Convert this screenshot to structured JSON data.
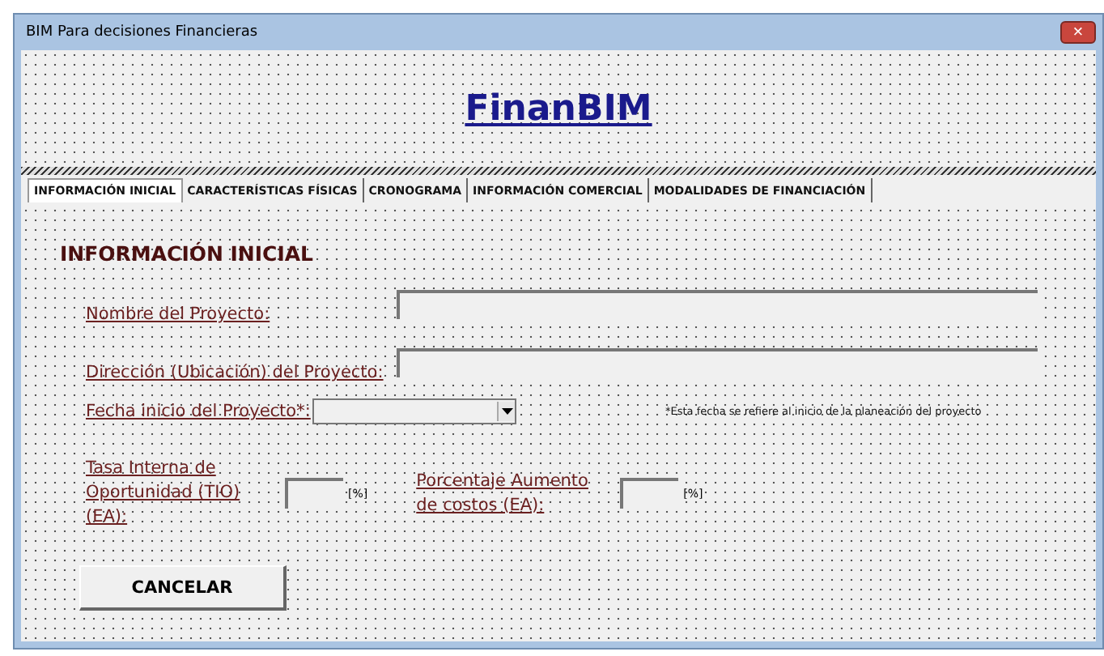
{
  "window": {
    "title": "BIM Para decisiones Financieras",
    "close": "×"
  },
  "logo": "FinanBIM",
  "tabs": [
    {
      "label": "INFORMACIÓN INICIAL",
      "selected": true
    },
    {
      "label": "CARACTERÍSTICAS FÍSICAS",
      "selected": false
    },
    {
      "label": "CRONOGRAMA",
      "selected": false
    },
    {
      "label": "INFORMACIÓN COMERCIAL",
      "selected": false
    },
    {
      "label": "MODALIDADES DE FINANCIACIÓN",
      "selected": false
    }
  ],
  "heading": "INFORMACIÓN INICIAL",
  "fields": [
    {
      "label": "Nombre del Proyecto:"
    },
    {
      "label": "Dirección (Ubicación) del Proyecto:"
    }
  ],
  "date": {
    "label": "Fecha inicio del Proyecto*:",
    "note": "*Esta fecha se refiere al inicio de la planeación del proyecto"
  },
  "rates": [
    {
      "label": "Tasa Interna de Oportunidad (TIO) (EA):",
      "unit": "[%]"
    },
    {
      "label": "Porcentaje Aumento de costos (EA):",
      "unit": "[%]"
    }
  ],
  "cancel": "CANCELAR"
}
